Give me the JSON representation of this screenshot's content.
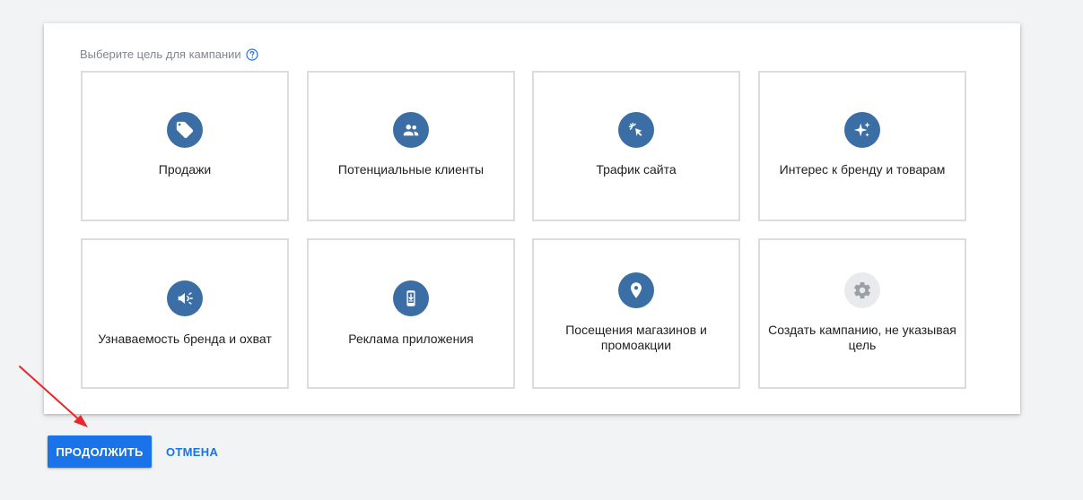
{
  "heading": {
    "title": "Выберите цель для кампании",
    "help_icon": "help-circle-icon"
  },
  "tiles": [
    {
      "label": "Продажи",
      "icon": "tag-icon"
    },
    {
      "label": "Потенциальные клиенты",
      "icon": "people-icon"
    },
    {
      "label": "Трафик сайта",
      "icon": "cursor-click-icon"
    },
    {
      "label": "Интерес к бренду и товарам",
      "icon": "sparkle-icon"
    },
    {
      "label": "Узнаваемость бренда и охват",
      "icon": "megaphone-icon"
    },
    {
      "label": "Реклама приложения",
      "icon": "phone-download-icon"
    },
    {
      "label": "Посещения магазинов и промоакции",
      "icon": "location-pin-icon"
    },
    {
      "label": "Создать кампанию, не указывая цель",
      "icon": "gear-icon"
    }
  ],
  "actions": {
    "continue_label": "ПРОДОЛЖИТЬ",
    "cancel_label": "ОТМЕНА"
  },
  "colors": {
    "icon_circle": "#3a6ea5",
    "icon_circle_disabled": "#e8eaed",
    "primary_button": "#1a73e8",
    "annotation_arrow": "#e8262b",
    "background": "#f1f3f4"
  }
}
